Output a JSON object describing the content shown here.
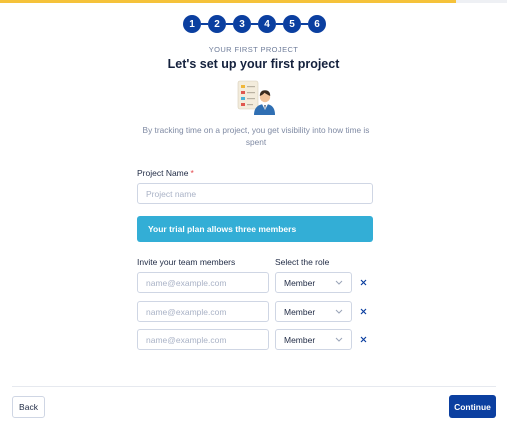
{
  "progress": {
    "fraction": 0.9,
    "color": "#f5c23a"
  },
  "steps": [
    "1",
    "2",
    "3",
    "4",
    "5",
    "6"
  ],
  "header": {
    "eyebrow": "YOUR FIRST PROJECT",
    "title": "Let's set up your first project",
    "illustration": "project-board-with-person-illustration",
    "subtitle": "By tracking time on a project, you get visibility into how time is spent"
  },
  "project": {
    "label": "Project Name",
    "required_mark": "*",
    "placeholder": "Project name",
    "value": ""
  },
  "banner": {
    "text": "Your trial plan allows three members"
  },
  "members": {
    "invite_label": "Invite your team members",
    "role_label": "Select the role",
    "rows": [
      {
        "placeholder": "name@example.com",
        "value": "",
        "role": "Member"
      },
      {
        "placeholder": "name@example.com",
        "value": "",
        "role": "Member"
      },
      {
        "placeholder": "name@example.com",
        "value": "",
        "role": "Member"
      }
    ]
  },
  "footer": {
    "back_label": "Back",
    "continue_label": "Continue"
  },
  "colors": {
    "primary": "#0b3fa0",
    "banner": "#33aed6",
    "required": "#e5484d"
  }
}
